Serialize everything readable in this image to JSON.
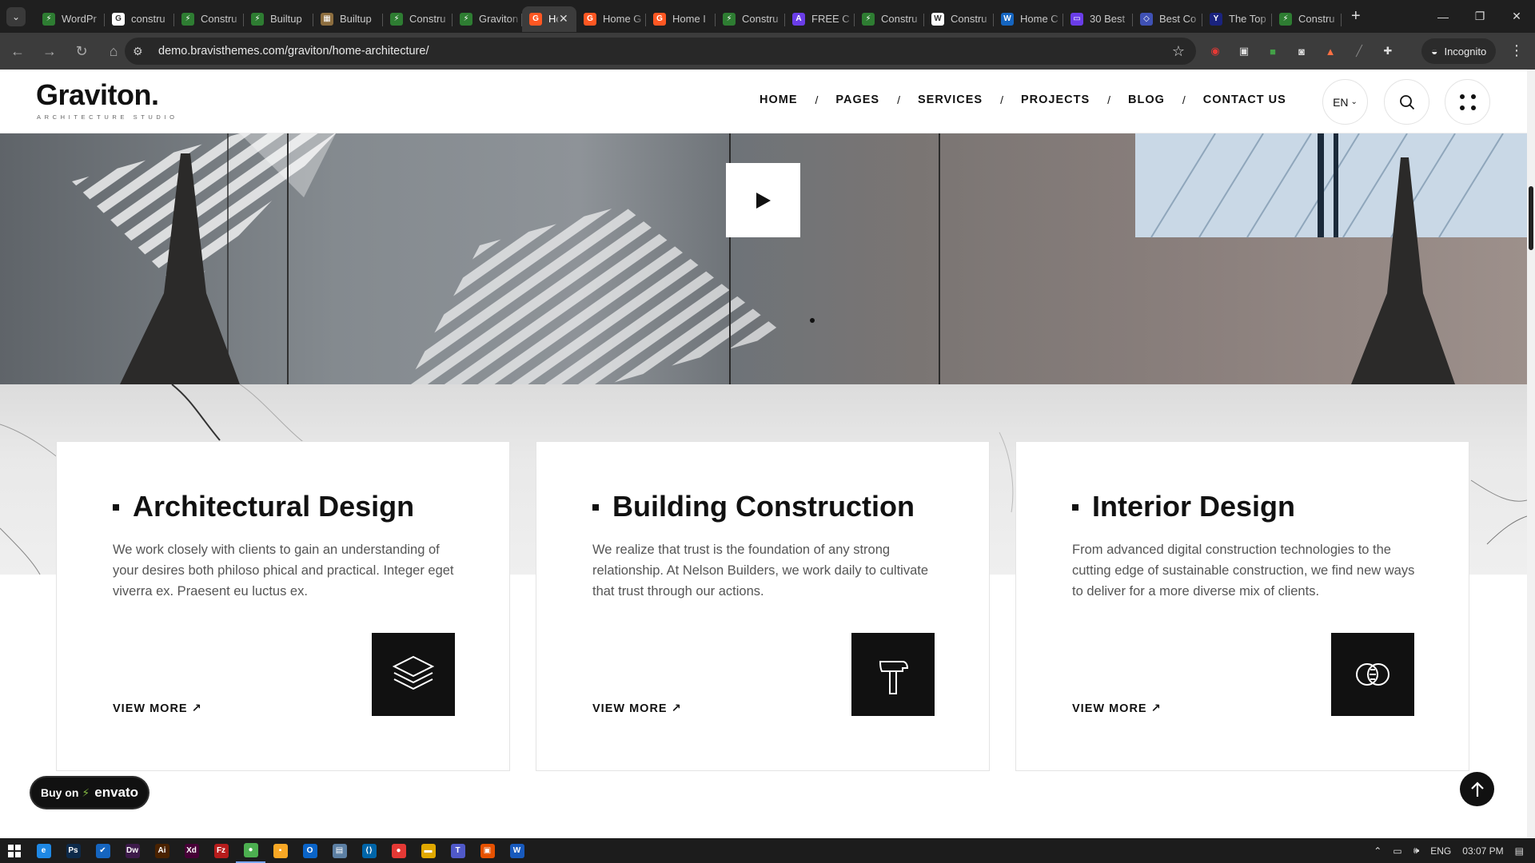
{
  "browser": {
    "tabs": [
      {
        "title": "WordPr",
        "favicon_color": "#2e7d32",
        "favicon_glyph": "⚡"
      },
      {
        "title": "constru",
        "favicon_color": "#ffffff",
        "favicon_glyph": "G"
      },
      {
        "title": "Constru",
        "favicon_color": "#2e7d32",
        "favicon_glyph": "⚡"
      },
      {
        "title": "Builtup",
        "favicon_color": "#2e7d32",
        "favicon_glyph": "⚡"
      },
      {
        "title": "Builtup",
        "favicon_color": "#8d6e3f",
        "favicon_glyph": "▦"
      },
      {
        "title": "Constru",
        "favicon_color": "#2e7d32",
        "favicon_glyph": "⚡"
      },
      {
        "title": "Graviton",
        "favicon_color": "#2e7d32",
        "favicon_glyph": "⚡"
      },
      {
        "title": "Hom",
        "favicon_color": "#ff5722",
        "favicon_glyph": "G",
        "active": true
      },
      {
        "title": "Home G",
        "favicon_color": "#ff5722",
        "favicon_glyph": "G"
      },
      {
        "title": "Home I",
        "favicon_color": "#ff5722",
        "favicon_glyph": "G"
      },
      {
        "title": "Constru",
        "favicon_color": "#2e7d32",
        "favicon_glyph": "⚡"
      },
      {
        "title": "FREE C",
        "favicon_color": "#6a3de8",
        "favicon_glyph": "A"
      },
      {
        "title": "Constru",
        "favicon_color": "#2e7d32",
        "favicon_glyph": "⚡"
      },
      {
        "title": "Constru",
        "favicon_color": "#ffffff",
        "favicon_glyph": "W"
      },
      {
        "title": "Home C",
        "favicon_color": "#1565c0",
        "favicon_glyph": "W"
      },
      {
        "title": "30 Best",
        "favicon_color": "#6a3de8",
        "favicon_glyph": "▭"
      },
      {
        "title": "Best Co",
        "favicon_color": "#3f51b5",
        "favicon_glyph": "◇"
      },
      {
        "title": "The Top",
        "favicon_color": "#1a237e",
        "favicon_glyph": "Y"
      },
      {
        "title": "Constru",
        "favicon_color": "#2e7d32",
        "favicon_glyph": "⚡"
      }
    ],
    "url": "demo.bravisthemes.com/graviton/home-architecture/",
    "profile_label": "Incognito"
  },
  "site": {
    "logo": "Graviton.",
    "logo_sub": "ARCHITECTURE STUDIO",
    "nav": [
      "HOME",
      "PAGES",
      "SERVICES",
      "PROJECTS",
      "BLOG",
      "CONTACT US"
    ],
    "nav_separator": "/",
    "lang": "EN"
  },
  "services": [
    {
      "title": "Architectural Design",
      "text": "We work closely with clients to gain an understanding of your desires both philoso phical and practical. Integer eget viverra ex. Praesent eu luctus ex.",
      "link": "VIEW MORE ↗",
      "icon": "layers-icon"
    },
    {
      "title": "Building Construction",
      "text": "We realize that trust is the foundation of any strong relationship. At Nelson Builders, we work daily to cultivate that trust through our actions.",
      "link": "VIEW MORE ↗",
      "icon": "hammer-icon"
    },
    {
      "title": "Interior Design",
      "text": "From advanced digital construction technologies to the cutting edge of sustainable construction, we find new ways to deliver for a more diverse mix of clients.",
      "link": "VIEW MORE ↗",
      "icon": "rings-icon"
    }
  ],
  "envato": {
    "prefix": "Buy on",
    "brand": "envato"
  },
  "taskbar": {
    "apps": [
      {
        "name": "edge",
        "color": "#1e88e5",
        "glyph": "e"
      },
      {
        "name": "photoshop",
        "color": "#0d2a4a",
        "glyph": "Ps"
      },
      {
        "name": "todo",
        "color": "#1565c0",
        "glyph": "✔"
      },
      {
        "name": "dreamweaver",
        "color": "#3d1a4a",
        "glyph": "Dw"
      },
      {
        "name": "illustrator",
        "color": "#4a2200",
        "glyph": "Ai"
      },
      {
        "name": "xd",
        "color": "#470137",
        "glyph": "Xd"
      },
      {
        "name": "filezilla",
        "color": "#b71c1c",
        "glyph": "Fz"
      },
      {
        "name": "chrome",
        "color": "#4caf50",
        "glyph": "●",
        "active": true
      },
      {
        "name": "sticky-notes",
        "color": "#f9a825",
        "glyph": "▪"
      },
      {
        "name": "outlook",
        "color": "#0a64c8",
        "glyph": "O"
      },
      {
        "name": "notepad",
        "color": "#5c7fa3",
        "glyph": "▤"
      },
      {
        "name": "vscode",
        "color": "#0065a9",
        "glyph": "⟨⟩"
      },
      {
        "name": "chrome-2",
        "color": "#e53935",
        "glyph": "●"
      },
      {
        "name": "explorer",
        "color": "#e0a800",
        "glyph": "▬"
      },
      {
        "name": "teams",
        "color": "#5059c9",
        "glyph": "T"
      },
      {
        "name": "app-orange",
        "color": "#e65100",
        "glyph": "▣"
      },
      {
        "name": "word",
        "color": "#185abd",
        "glyph": "W"
      }
    ],
    "lang": "ENG",
    "time": "03:07 PM"
  }
}
